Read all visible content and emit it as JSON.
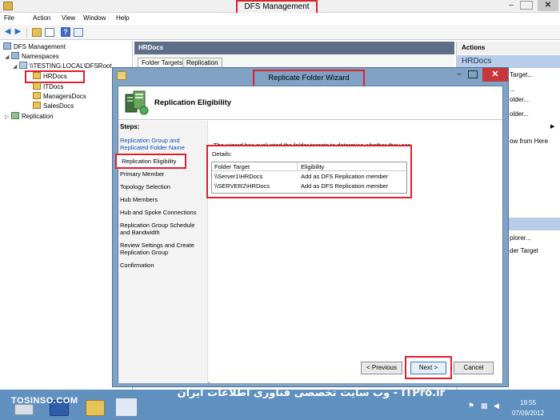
{
  "window": {
    "title": "DFS Management",
    "controls": {
      "minimize": "–",
      "maximize": "□",
      "close": "✕"
    }
  },
  "menu": [
    "File",
    "Action",
    "View",
    "Window",
    "Help"
  ],
  "tree": {
    "root": "DFS Management",
    "namespaces": "Namespaces",
    "namespace_root": "\\\\TESTING.LOCAL\\DFSRoot",
    "folders": [
      "HRDocs",
      "ITDocs",
      "ManagersDocs",
      "SalesDocs"
    ],
    "replication": "Replication"
  },
  "center": {
    "header": "HRDocs",
    "tabs": [
      "Folder Targets",
      "Replication"
    ]
  },
  "actions": {
    "title": "Actions",
    "group1": {
      "heading": "HRDocs",
      "items": [
        "Target...",
        "...",
        "older...",
        "older...",
        "ow from Here"
      ]
    },
    "group2": {
      "heading": "tDocs",
      "items": [
        "plorer...",
        "der Target"
      ]
    }
  },
  "wizard": {
    "title": "Replicate Folder Wizard",
    "heading": "Replication Eligibility",
    "steps_title": "Steps:",
    "steps": [
      "Replication Group and Replicated Folder Name",
      "Replication Eligibility",
      "Primary Member",
      "Topology Selection",
      "Hub Members",
      "Hub and Spoke Connections",
      "Replication Group Schedule and Bandwidth",
      "Review Settings and Create Replication Group",
      "Confirmation"
    ],
    "description": "The wizard has evaluated the folder targets to determine whether they can participate in DFS Replication. See the Eligibility column below for details.",
    "details_label": "Details:",
    "table": {
      "columns": [
        "Folder Target",
        "Eligibility"
      ],
      "rows": [
        [
          "\\\\Server1\\HRDocs",
          "Add as DFS Replication member"
        ],
        [
          "\\\\SERVER2\\HRDocs",
          "Add as DFS Replication member"
        ]
      ]
    },
    "buttons": {
      "previous": "< Previous",
      "next": "Next >",
      "cancel": "Cancel"
    },
    "controls": {
      "minimize": "–",
      "close": "✕"
    }
  },
  "taskbar": {
    "watermark_left": "TOSINSO.COM",
    "watermark_right": "ITPro.ir - وب سایت تخصصی فناوری اطلاعات ایران",
    "time": "19:55",
    "date": "07/09/2012"
  },
  "colors": {
    "highlight": "#e0202a",
    "wizard_frame": "#7fa2c5",
    "taskbar": "#5f90bf",
    "link": "#0b4fb0"
  }
}
